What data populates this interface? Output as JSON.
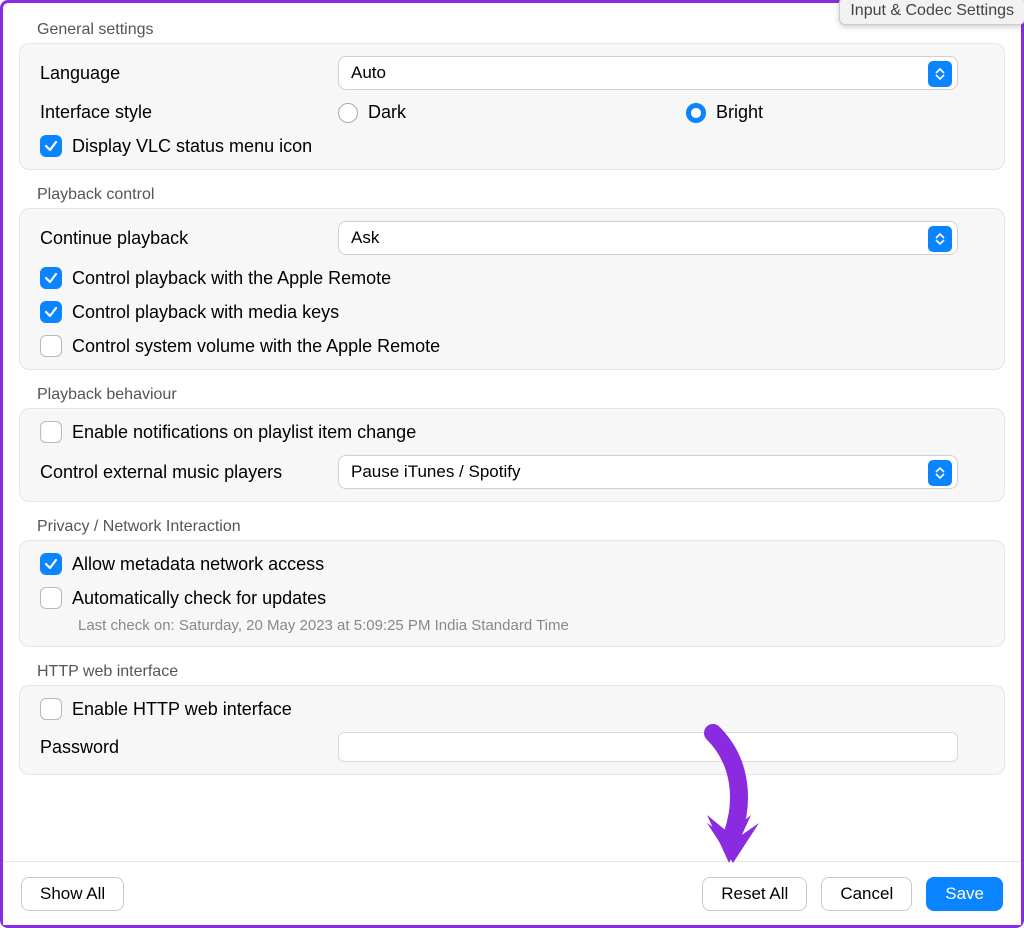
{
  "overlay_tooltip": "Input & Codec Settings",
  "sections": {
    "general": {
      "title": "General settings",
      "language_label": "Language",
      "language_value": "Auto",
      "interface_style_label": "Interface style",
      "radio_dark": "Dark",
      "radio_bright": "Bright",
      "display_status_menu": "Display VLC status menu icon"
    },
    "playback_control": {
      "title": "Playback control",
      "continue_playback_label": "Continue playback",
      "continue_playback_value": "Ask",
      "apple_remote": "Control playback with the Apple Remote",
      "media_keys": "Control playback with media keys",
      "system_volume": "Control system volume with the Apple Remote"
    },
    "playback_behaviour": {
      "title": "Playback behaviour",
      "notifications": "Enable notifications on playlist item change",
      "external_players_label": "Control external music players",
      "external_players_value": "Pause iTunes / Spotify"
    },
    "privacy": {
      "title": "Privacy / Network Interaction",
      "metadata": "Allow metadata network access",
      "auto_update": "Automatically check for updates",
      "last_check": "Last check on: Saturday, 20 May 2023 at 5:09:25 PM India Standard Time"
    },
    "http": {
      "title": "HTTP web interface",
      "enable": "Enable HTTP web interface",
      "password_label": "Password",
      "password_value": ""
    }
  },
  "buttons": {
    "show_all": "Show All",
    "reset_all": "Reset All",
    "cancel": "Cancel",
    "save": "Save"
  }
}
